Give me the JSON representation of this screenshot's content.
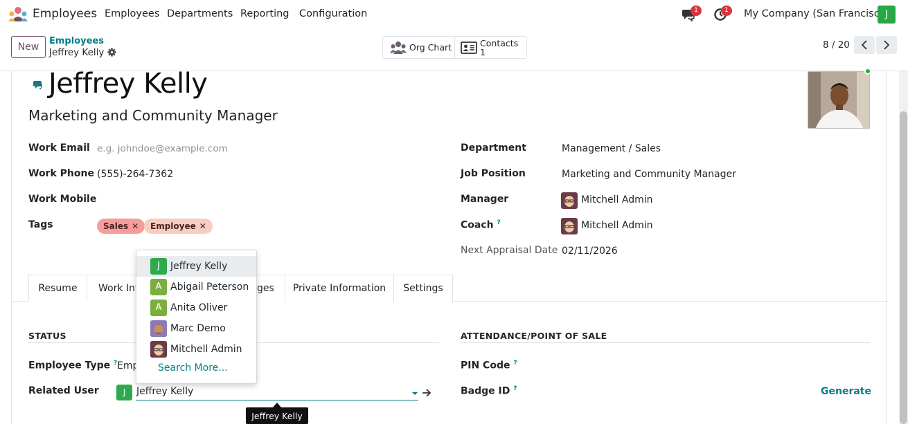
{
  "navbar": {
    "app_name": "Employees",
    "menus": [
      "Employees",
      "Departments",
      "Reporting",
      "Configuration"
    ],
    "messages_count": "1",
    "activities_count": "1",
    "company": "My Company (San Francisco)",
    "user_initial": "J"
  },
  "control": {
    "new_label": "New",
    "breadcrumb_parent": "Employees",
    "breadcrumb_current": "Jeffrey Kelly",
    "org_chart_label": "Org Chart",
    "contacts_label": "Contacts",
    "contacts_count": "1",
    "pager": "8 / 20"
  },
  "employee": {
    "name": "Jeffrey Kelly",
    "job_title": "Marketing and Community Manager"
  },
  "left_fields": {
    "work_email_label": "Work Email",
    "work_email_placeholder": "e.g. johndoe@example.com",
    "work_phone_label": "Work Phone",
    "work_phone": "(555)-264-7362",
    "work_mobile_label": "Work Mobile",
    "tags_label": "Tags",
    "tags": [
      {
        "label": "Sales",
        "color": "#f59c9c"
      },
      {
        "label": "Employee",
        "color": "#f7cdc0"
      }
    ]
  },
  "right_fields": {
    "department_label": "Department",
    "department": "Management / Sales",
    "job_position_label": "Job Position",
    "job_position": "Marketing and Community Manager",
    "manager_label": "Manager",
    "manager": "Mitchell Admin",
    "coach_label": "Coach",
    "coach": "Mitchell Admin",
    "next_appraisal_label": "Next Appraisal Date",
    "next_appraisal": "02/11/2026"
  },
  "tabs": [
    "Resume",
    "Work Inf",
    "ges",
    "Private Information",
    "Settings"
  ],
  "settings": {
    "status_title": "STATUS",
    "employee_type_label": "Employee Type",
    "employee_type": "Emp",
    "related_user_label": "Related User",
    "related_user": "Jeffrey Kelly",
    "related_user_initial": "J",
    "attendance_title": "ATTENDANCE/POINT OF SALE",
    "pin_code_label": "PIN Code",
    "badge_id_label": "Badge ID",
    "generate_label": "Generate"
  },
  "dropdown": {
    "items": [
      {
        "name": "Jeffrey Kelly",
        "initial": "J",
        "color": "#2ea94b"
      },
      {
        "name": "Abigail Peterson",
        "initial": "A",
        "color": "#7cae3f"
      },
      {
        "name": "Anita Oliver",
        "initial": "A",
        "color": "#7cae3f"
      },
      {
        "name": "Marc Demo",
        "initial": "",
        "color": "#8a7bb8"
      },
      {
        "name": "Mitchell Admin",
        "initial": "",
        "color": "#6b3b4a"
      }
    ],
    "search_more": "Search More..."
  },
  "tooltip": "Jeffrey Kelly",
  "colors": {
    "brand": "#714b67",
    "accent": "#017e84"
  }
}
